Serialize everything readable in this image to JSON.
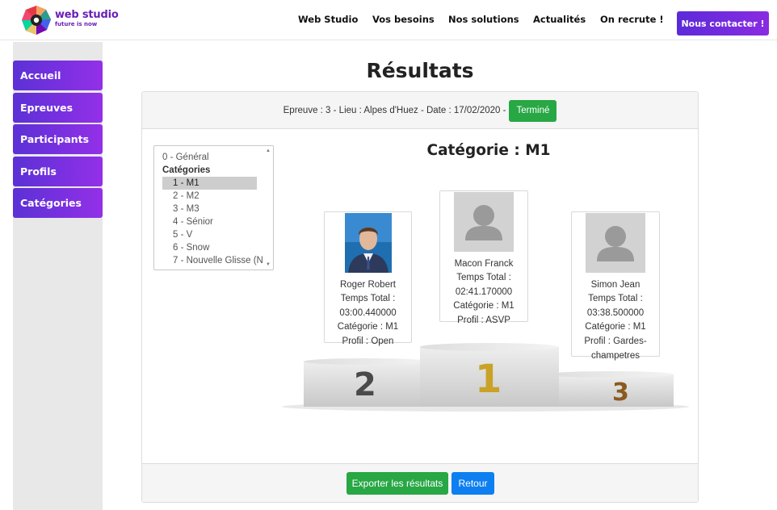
{
  "brand": {
    "name": "web studio",
    "tagline": "future is now"
  },
  "nav": {
    "items": [
      "Web Studio",
      "Vos besoins",
      "Nos solutions",
      "Actualités",
      "On recrute !"
    ],
    "cta": "Nous contacter !"
  },
  "sidebar": {
    "items": [
      "Accueil",
      "Epreuves",
      "Participants",
      "Profils",
      "Catégories"
    ]
  },
  "page": {
    "title": "Résultats"
  },
  "event": {
    "info": "Epreuve : 3 - Lieu : Alpes d'Huez - Date : 17/02/2020 -",
    "status": "Terminé"
  },
  "category_list": {
    "general": "0 - Général",
    "group_label": "Catégories",
    "options": [
      "1 - M1",
      "2 - M2",
      "3 - M3",
      "4 - Sénior",
      "5 - V",
      "6 - Snow",
      "7 - Nouvelle Glisse (N"
    ],
    "selected_index": 0
  },
  "category_title": "Catégorie : M1",
  "podium": {
    "first": {
      "lines": [
        "Macon Franck",
        "Temps Total :",
        "02:41.170000",
        "Catégorie : M1",
        "Profil : ASVP"
      ],
      "photo": "placeholder-avatar"
    },
    "second": {
      "lines": [
        "Roger Robert",
        "Temps Total :",
        "03:00.440000",
        "Catégorie : M1",
        "Profil : Open"
      ],
      "photo": "portrait"
    },
    "third": {
      "lines": [
        "Simon Jean",
        "Temps Total :",
        "03:38.500000",
        "Catégorie : M1",
        "Profil : Gardes-",
        "champetres"
      ],
      "photo": "placeholder-avatar"
    },
    "numbers": [
      "1",
      "2",
      "3"
    ]
  },
  "footer": {
    "export_label": "Exporter les résultats",
    "back_label": "Retour"
  },
  "colors": {
    "accent_purple": "#7b2ee0",
    "success": "#28a745",
    "primary": "#0d7ff0",
    "gold": "#c9a227",
    "bronze": "#b5651d"
  }
}
